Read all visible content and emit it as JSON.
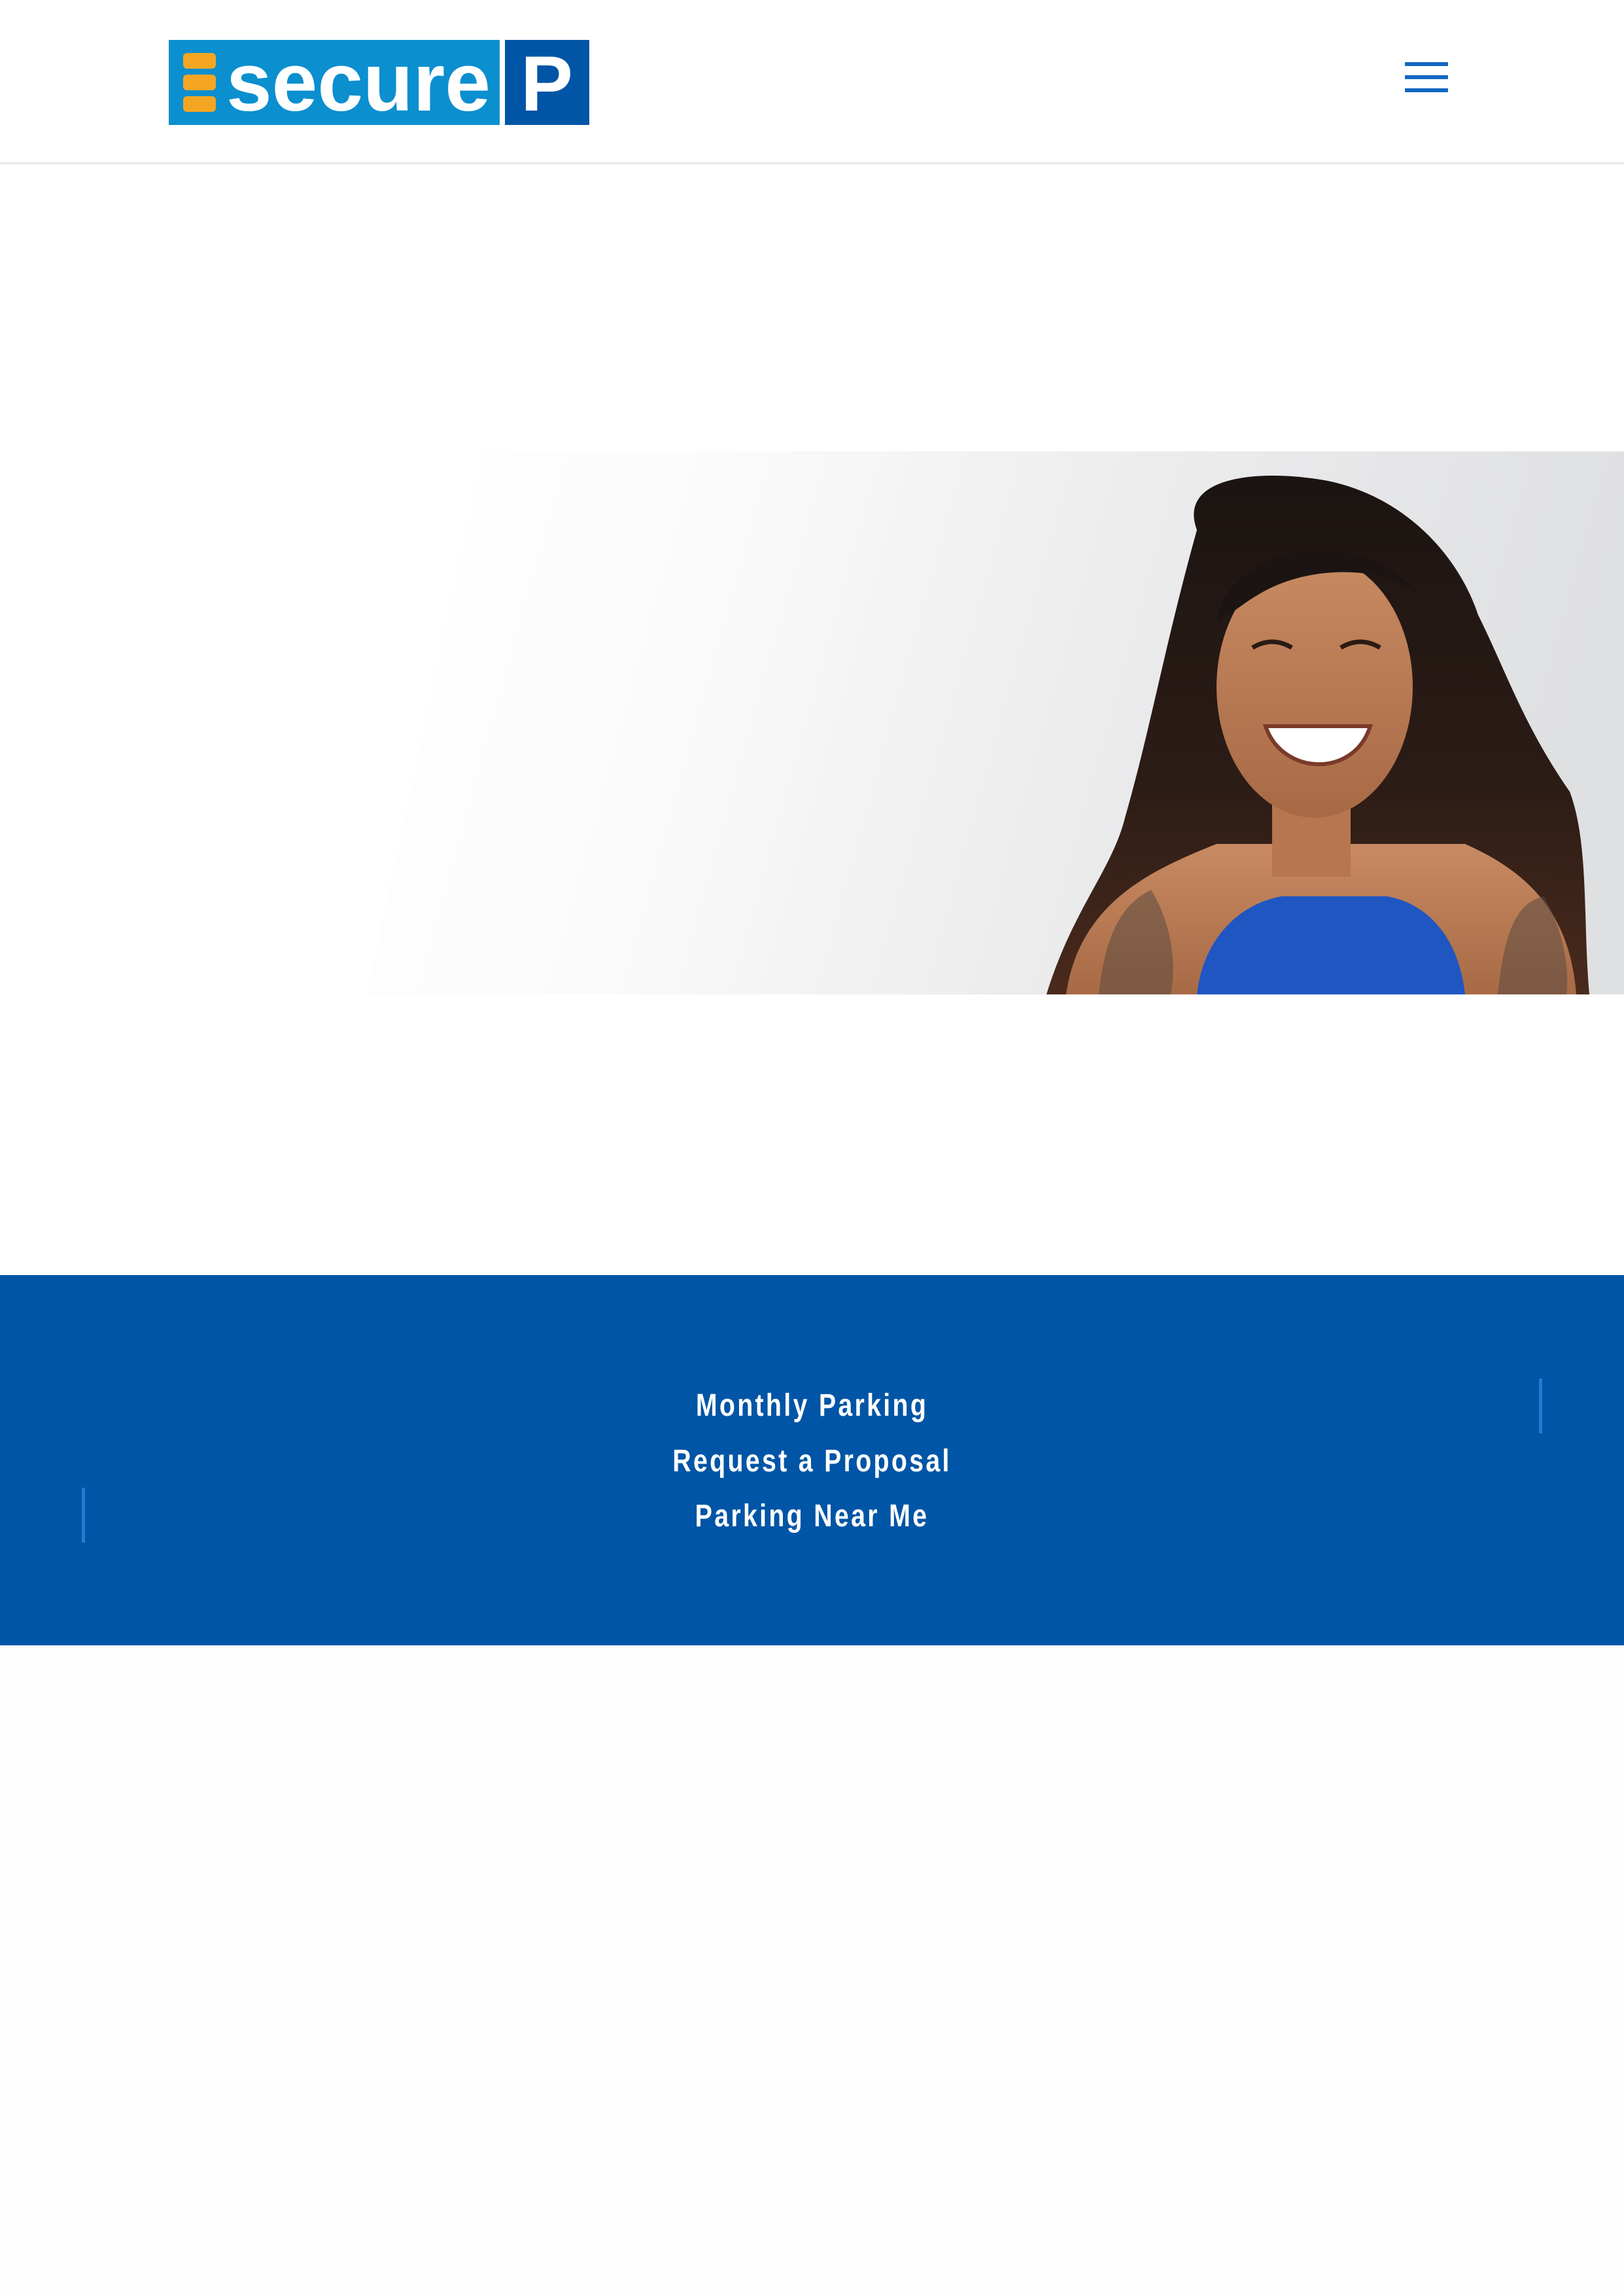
{
  "header": {
    "logo": {
      "text": "secure",
      "badge": "P",
      "colors": {
        "primary": "#0b8fcf",
        "badge": "#0055a6",
        "accent": "#f4a623"
      }
    },
    "menu_icon": "hamburger-menu-icon"
  },
  "hero": {
    "image": "smiling-woman-portrait"
  },
  "footer": {
    "links": [
      "Monthly Parking",
      "Request a Proposal",
      "Parking Near Me"
    ],
    "background": "#0055a6"
  }
}
